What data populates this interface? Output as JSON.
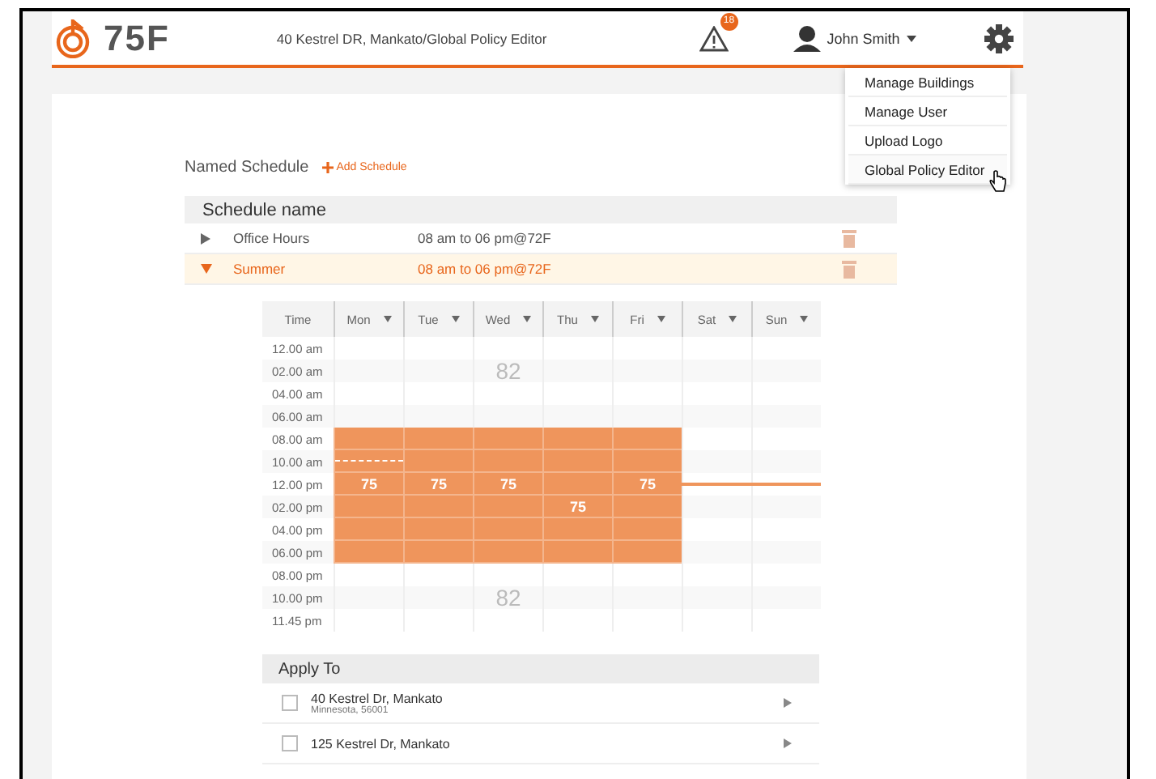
{
  "header": {
    "logo_text": "75F",
    "breadcrumb": "40 Kestrel DR, Mankato/Global Policy Editor",
    "alert_count": "18",
    "user_name": "John Smith"
  },
  "settings_menu": {
    "items": [
      {
        "label": "Manage Buildings",
        "hovered": false
      },
      {
        "label": "Manage User",
        "hovered": false
      },
      {
        "label": "Upload Logo",
        "hovered": false
      },
      {
        "label": "Global Policy Editor",
        "hovered": true
      }
    ]
  },
  "named_schedule": {
    "title": "Named Schedule",
    "add_label": "Add Schedule",
    "column_header": "Schedule name",
    "rows": [
      {
        "name": "Office Hours",
        "summary": "08 am to 06 pm@72F",
        "expanded": false
      },
      {
        "name": "Summer",
        "summary": "08 am to 06 pm@72F",
        "expanded": true
      }
    ]
  },
  "schedule_grid": {
    "time_header": "Time",
    "days": [
      "Mon",
      "Tue",
      "Wed",
      "Thu",
      "Fri",
      "Sat",
      "Sun"
    ],
    "rows": [
      {
        "time": "12.00 am",
        "cells": [
          {
            "occupied": false
          },
          {
            "occupied": false
          },
          {
            "occupied": false
          },
          {
            "occupied": false
          },
          {
            "occupied": false
          },
          {
            "occupied": false
          },
          {
            "occupied": false
          }
        ]
      },
      {
        "time": "02.00 am",
        "cells": [
          {
            "occupied": false
          },
          {
            "occupied": false
          },
          {
            "occupied": false,
            "label": "82"
          },
          {
            "occupied": false
          },
          {
            "occupied": false
          },
          {
            "occupied": false
          },
          {
            "occupied": false
          }
        ]
      },
      {
        "time": "04.00 am",
        "cells": [
          {
            "occupied": false
          },
          {
            "occupied": false
          },
          {
            "occupied": false
          },
          {
            "occupied": false
          },
          {
            "occupied": false
          },
          {
            "occupied": false
          },
          {
            "occupied": false
          }
        ]
      },
      {
        "time": "06.00 am",
        "cells": [
          {
            "occupied": false
          },
          {
            "occupied": false
          },
          {
            "occupied": false
          },
          {
            "occupied": false
          },
          {
            "occupied": false
          },
          {
            "occupied": false
          },
          {
            "occupied": false
          }
        ]
      },
      {
        "time": "08.00 am",
        "cells": [
          {
            "occupied": true
          },
          {
            "occupied": true
          },
          {
            "occupied": true
          },
          {
            "occupied": true
          },
          {
            "occupied": true
          },
          {
            "occupied": false
          },
          {
            "occupied": false
          }
        ]
      },
      {
        "time": "10.00 am",
        "cells": [
          {
            "occupied": true
          },
          {
            "occupied": true
          },
          {
            "occupied": true
          },
          {
            "occupied": true
          },
          {
            "occupied": true
          },
          {
            "occupied": false
          },
          {
            "occupied": false
          }
        ]
      },
      {
        "time": "12.00 pm",
        "cells": [
          {
            "occupied": true,
            "label": "75"
          },
          {
            "occupied": true,
            "label": "75"
          },
          {
            "occupied": true,
            "label": "75"
          },
          {
            "occupied": true
          },
          {
            "occupied": true,
            "label": "75"
          },
          {
            "occupied": false
          },
          {
            "occupied": false
          }
        ]
      },
      {
        "time": "02.00 pm",
        "cells": [
          {
            "occupied": true
          },
          {
            "occupied": true
          },
          {
            "occupied": true
          },
          {
            "occupied": true,
            "label": "75"
          },
          {
            "occupied": true
          },
          {
            "occupied": false
          },
          {
            "occupied": false
          }
        ]
      },
      {
        "time": "04.00 pm",
        "cells": [
          {
            "occupied": true
          },
          {
            "occupied": true
          },
          {
            "occupied": true
          },
          {
            "occupied": true
          },
          {
            "occupied": true
          },
          {
            "occupied": false
          },
          {
            "occupied": false
          }
        ]
      },
      {
        "time": "06.00 pm",
        "cells": [
          {
            "occupied": true
          },
          {
            "occupied": true
          },
          {
            "occupied": true
          },
          {
            "occupied": true
          },
          {
            "occupied": true
          },
          {
            "occupied": false
          },
          {
            "occupied": false
          }
        ]
      },
      {
        "time": "08.00 pm",
        "cells": [
          {
            "occupied": false
          },
          {
            "occupied": false
          },
          {
            "occupied": false
          },
          {
            "occupied": false
          },
          {
            "occupied": false
          },
          {
            "occupied": false
          },
          {
            "occupied": false
          }
        ]
      },
      {
        "time": "10.00 pm",
        "cells": [
          {
            "occupied": false
          },
          {
            "occupied": false
          },
          {
            "occupied": false,
            "label": "82"
          },
          {
            "occupied": false
          },
          {
            "occupied": false
          },
          {
            "occupied": false
          },
          {
            "occupied": false
          }
        ]
      },
      {
        "time": "11.45 pm",
        "cells": [
          {
            "occupied": false
          },
          {
            "occupied": false
          },
          {
            "occupied": false
          },
          {
            "occupied": false
          },
          {
            "occupied": false
          },
          {
            "occupied": false
          },
          {
            "occupied": false
          }
        ]
      }
    ]
  },
  "apply_to": {
    "title": "Apply To",
    "buildings": [
      {
        "name": "40 Kestrel Dr, Mankato",
        "address": "Minnesota, 56001",
        "checked": false
      },
      {
        "name": "125 Kestrel Dr, Mankato",
        "checked": false
      }
    ]
  }
}
